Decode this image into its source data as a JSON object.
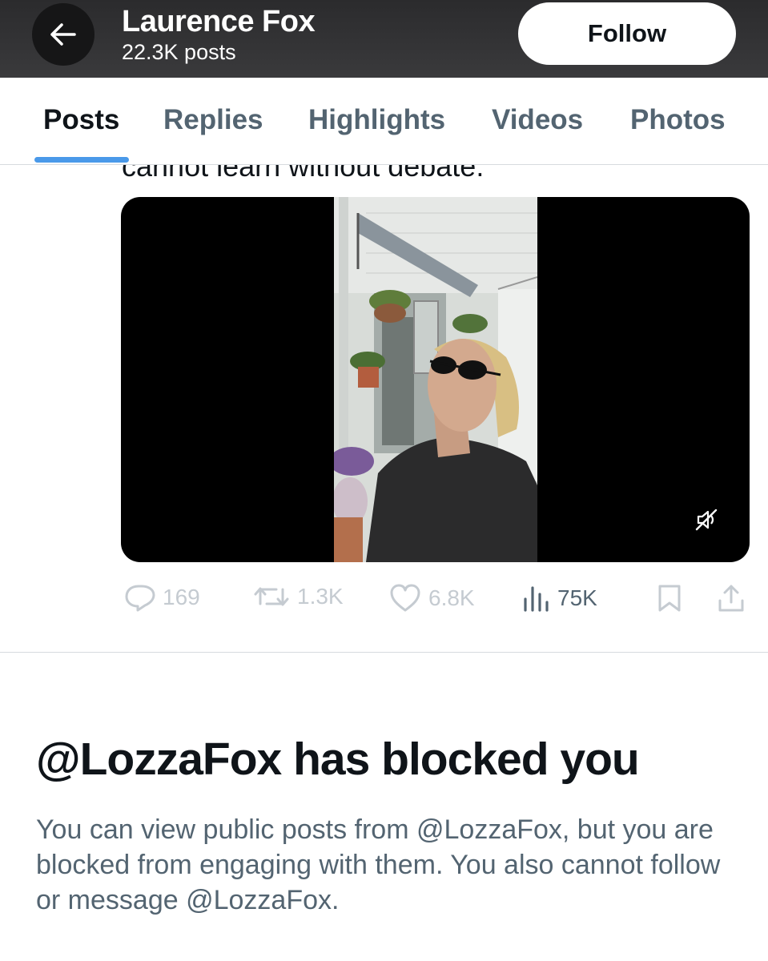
{
  "header": {
    "title": "Laurence Fox",
    "posts_count": "22.3K posts",
    "follow_label": "Follow",
    "back_icon": "arrow-left-icon"
  },
  "tabs": [
    {
      "label": "Posts",
      "active": true
    },
    {
      "label": "Replies",
      "active": false
    },
    {
      "label": "Highlights",
      "active": false
    },
    {
      "label": "Videos",
      "active": false
    },
    {
      "label": "Photos",
      "active": false
    }
  ],
  "post": {
    "partial_text": "cannot learn without debate.",
    "video": {
      "muted": true,
      "mute_icon": "speaker-muted-icon"
    },
    "actions": {
      "replies": "169",
      "reposts": "1.3K",
      "likes": "6.8K",
      "views": "75K"
    }
  },
  "block_notice": {
    "title": "@LozzaFox has blocked you",
    "description": "You can view public posts from @LozzaFox, but you are blocked from engaging with them. You also cannot follow or message @LozzaFox."
  },
  "colors": {
    "accent": "#4a99e9",
    "header_bg": "#333335",
    "text_primary": "#0f1419",
    "text_secondary": "#536471",
    "disabled": "#c5cbd1"
  }
}
